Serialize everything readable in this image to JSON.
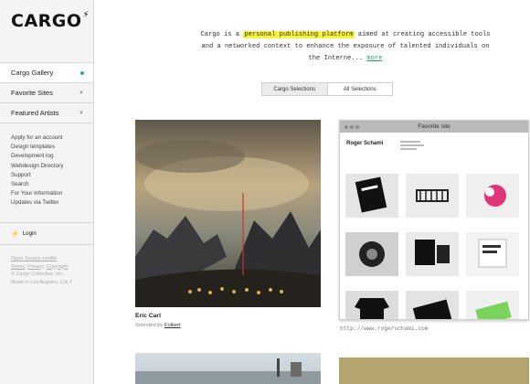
{
  "brand": {
    "logo": "CARGO",
    "logo_mark": "⚡"
  },
  "sidebar": {
    "nav": [
      {
        "label": "Cargo Gallery",
        "active": true
      },
      {
        "label": "Favorite Sites",
        "active": false
      },
      {
        "label": "Featured Artists",
        "active": false
      }
    ],
    "links": [
      "Apply for an account",
      "Design templates",
      "Development log",
      "Webdesign Directory",
      "Support",
      "Search",
      "For Your Information",
      "Updates via Twitter"
    ],
    "login_label": "Login",
    "footer": {
      "open_source": "Open Source credits",
      "terms": "Terms",
      "privacy": "Privacy",
      "copyright": "Copyright",
      "collective": "© Cargo Collective, Inc.",
      "made_in": "Made in Los Angeles, Cal.†"
    }
  },
  "intro": {
    "before": "Cargo is a ",
    "highlight": "personal publishing platform",
    "after": " aimed at creating accessible tools and a networked context to enhance the exposure of talented individuals on the Interne... ",
    "more": "more"
  },
  "tabs": {
    "selections": "Cargo Selections",
    "all": "All Selections"
  },
  "featured": {
    "title": "Eric Carl",
    "selected_by_prefix": "Selected by ",
    "selected_by": "Folkert"
  },
  "favorite_site": {
    "window_title": "Favorite site",
    "site_name": "Roger Schami",
    "url": "http://www.rogerschami.com"
  },
  "colors": {
    "accent_green": "#2bb673",
    "highlight": "#f5f33b"
  }
}
